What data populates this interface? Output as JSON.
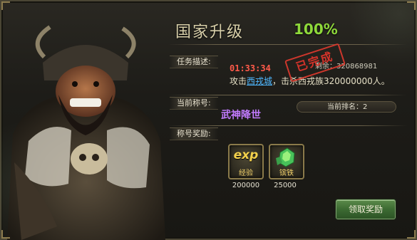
{
  "header": {
    "title": "国家升级",
    "progress": "100%"
  },
  "task": {
    "section_label": "任务描述:",
    "timer": "01:33:34",
    "remaining_prefix": "剩余：",
    "remaining_value": "320868981",
    "text_before_link": "攻击",
    "link_text": "西戎城",
    "text_after_link": "，击杀西戎族320000000人。",
    "stamp": "已完成"
  },
  "honor": {
    "section_label": "当前称号:",
    "name": "武神降世",
    "rank_label": "当前排名：",
    "rank_value": "2"
  },
  "rewards": {
    "section_label": "称号奖励:",
    "items": [
      {
        "icon": "exp-icon",
        "icon_text": "exp",
        "label": "经验",
        "count": "200000"
      },
      {
        "icon": "iron-ore-icon",
        "label": "镔铁",
        "count": "25000"
      }
    ]
  },
  "actions": {
    "claim_label": "领取奖励"
  },
  "colors": {
    "progress": "#8ed83a",
    "timer": "#ff5a4a",
    "link": "#4fb8ff",
    "honor": "#c27bff",
    "stamp": "#e03a2e"
  }
}
